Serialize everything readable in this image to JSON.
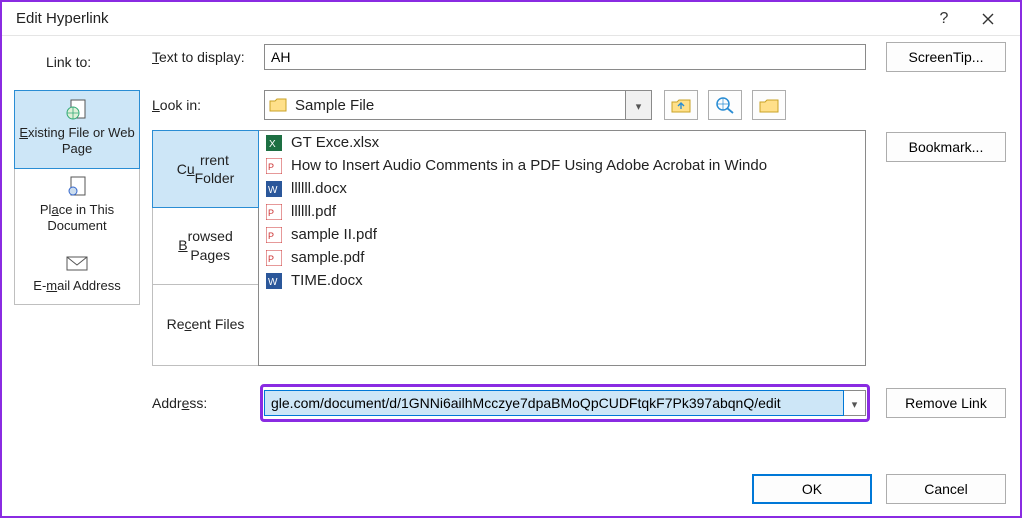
{
  "window": {
    "title": "Edit Hyperlink"
  },
  "sidebar": {
    "label": "Link to:",
    "items": [
      {
        "label": "Existing File or Web Page",
        "underline": "E"
      },
      {
        "label": "Place in This Document",
        "underline": "A"
      },
      {
        "label": "E-mail Address",
        "underline": "m"
      }
    ]
  },
  "textToDisplay": {
    "label": "Text to display:",
    "value": "AH"
  },
  "screenTipBtn": "ScreenTip...",
  "lookIn": {
    "label": "Look in:",
    "value": "Sample File"
  },
  "tabs": [
    {
      "label": "Current Folder",
      "underline": "u"
    },
    {
      "label": "Browsed Pages",
      "underline": "B"
    },
    {
      "label": "Recent Files",
      "underline": ""
    }
  ],
  "files": [
    {
      "name": "GT Exce.xlsx",
      "type": "xlsx"
    },
    {
      "name": "How to Insert Audio Comments in a PDF Using Adobe Acrobat in Windo",
      "type": "pdf"
    },
    {
      "name": "llllll.docx",
      "type": "docx"
    },
    {
      "name": "llllll.pdf",
      "type": "pdf"
    },
    {
      "name": "sample II.pdf",
      "type": "pdf"
    },
    {
      "name": "sample.pdf",
      "type": "pdf"
    },
    {
      "name": "TIME.docx",
      "type": "docx"
    }
  ],
  "bookmarkBtn": "Bookmark...",
  "address": {
    "label": "Address:",
    "value": "gle.com/document/d/1GNNi6ailhMcczye7dpaBMoQpCUDFtqkF7Pk397abqnQ/edit"
  },
  "removeLinkBtn": "Remove Link",
  "okBtn": "OK",
  "cancelBtn": "Cancel"
}
